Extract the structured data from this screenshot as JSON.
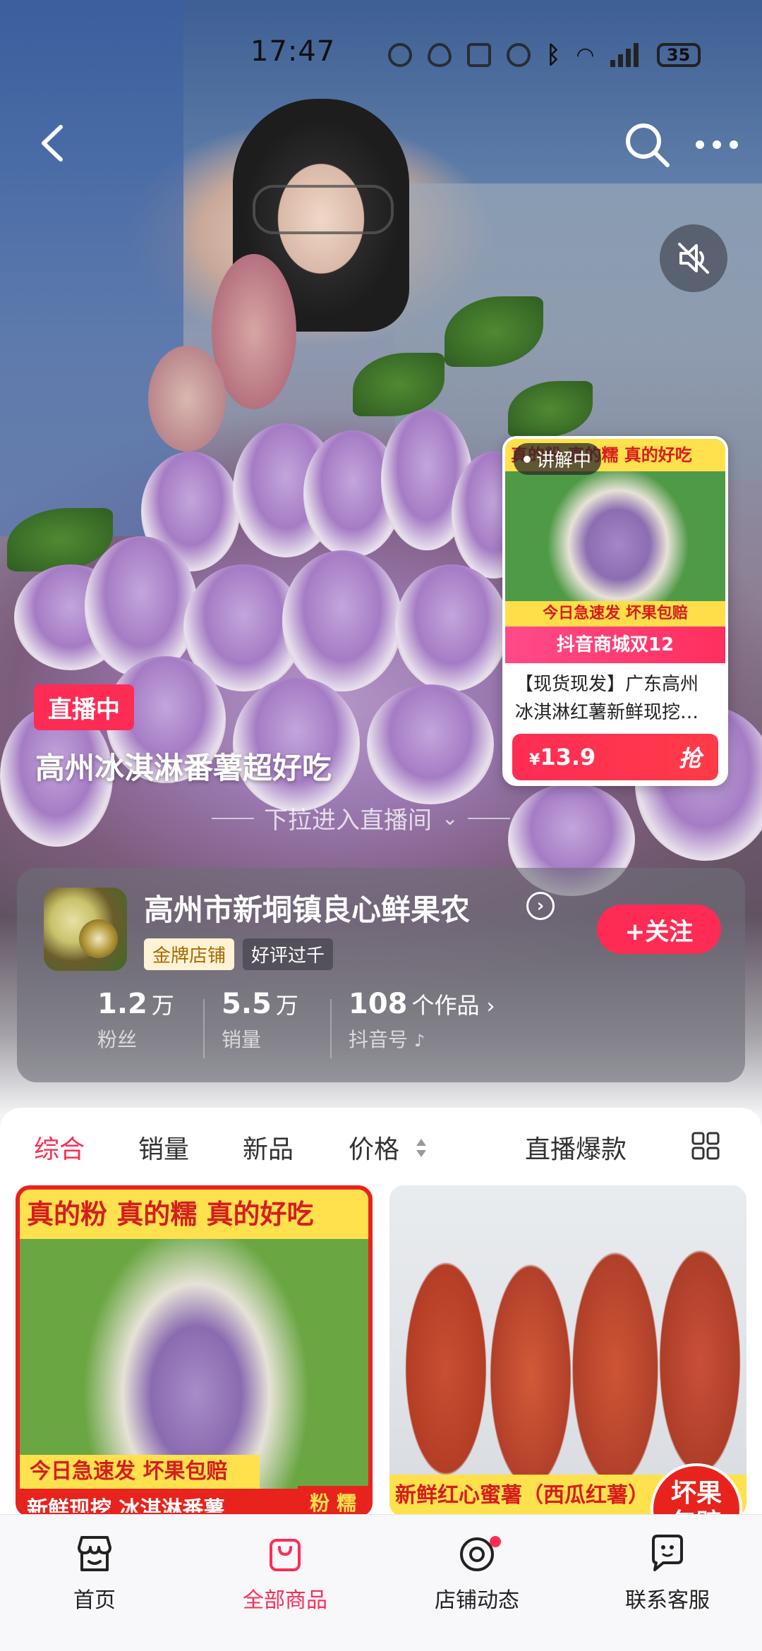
{
  "status_bar": {
    "time": "17:47",
    "battery": "35",
    "network": "4G",
    "icons": [
      "notification-icon",
      "eye-icon",
      "nfc-icon",
      "dnd-icon",
      "bluetooth-icon",
      "wifi-icon",
      "signal-icon",
      "battery-icon"
    ]
  },
  "live": {
    "badge": "直播中",
    "title": "高州冰淇淋番薯超好吃",
    "pull_hint": "下拉进入直播间"
  },
  "explain_card": {
    "tag": "讲解中",
    "top_banner": "真的粉 真的糯 真的好吃",
    "image_banner": "今日急速发 坏果包赔",
    "festival": "抖音商城双12",
    "title": "【现货现发】广东高州冰淇淋红薯新鲜现挖…",
    "price_symbol": "¥",
    "price": "13.9",
    "grab_label": "抢"
  },
  "shop": {
    "name": "高州市新垌镇良心鲜果农",
    "tags": [
      "金牌店铺",
      "好评过千"
    ],
    "follow_label": "+关注",
    "stats": [
      {
        "num": "1.2",
        "unit": "万",
        "label": "粉丝"
      },
      {
        "num": "5.5",
        "unit": "万",
        "label": "销量"
      },
      {
        "num": "108",
        "unit": "个作品",
        "label": "抖音号"
      }
    ]
  },
  "tabs": [
    "综合",
    "销量",
    "新品",
    "价格",
    "直播爆款"
  ],
  "products": [
    {
      "top": "真的粉 真的糯 真的好吃",
      "mid": "今日急速发 坏果包赔",
      "bottom": "新鲜现挖 冰淇淋番薯",
      "badge": "粉 糯"
    },
    {
      "bottom": "新鲜红心蜜薯（西瓜红薯）",
      "badge_line1": "坏果",
      "badge_line2": "包赔"
    }
  ],
  "bottom_nav": [
    {
      "label": "首页",
      "icon": "shop-home-icon",
      "active": false
    },
    {
      "label": "全部商品",
      "icon": "shopping-bag-icon",
      "active": true
    },
    {
      "label": "店铺动态",
      "icon": "shop-feed-icon",
      "active": false
    },
    {
      "label": "联系客服",
      "icon": "customer-service-icon",
      "active": false
    }
  ],
  "colors": {
    "accent": "#fe2c55",
    "badge_yellow": "#ffe14d",
    "banner_red": "#e8231d"
  }
}
